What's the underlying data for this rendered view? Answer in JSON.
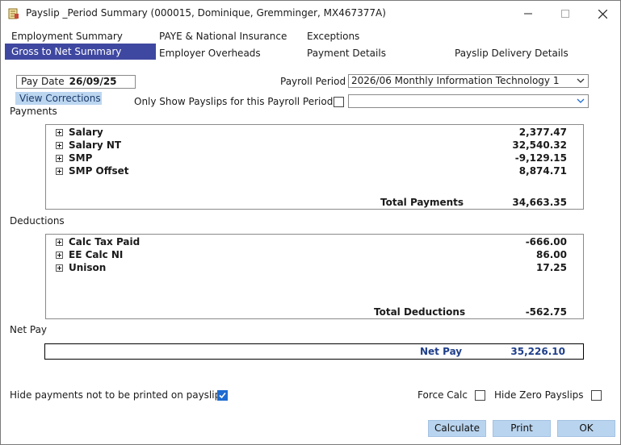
{
  "window": {
    "title": "Payslip _Period Summary (000015, Dominique, Gremminger, MX467377A)",
    "minimize": "—",
    "maximize": "☐",
    "close": "✕"
  },
  "tabs": {
    "employment_summary": "Employment Summary",
    "gross_to_net": "Gross to Net Summary",
    "paye_ni": "PAYE & National Insurance",
    "employer_overheads": "Employer Overheads",
    "exceptions": "Exceptions",
    "payment_details": "Payment Details",
    "payslip_delivery": "Payslip Delivery Details"
  },
  "header": {
    "pay_date_label": "Pay Date",
    "pay_date_value": "26/09/25",
    "view_corrections": "View Corrections",
    "payroll_period_label": "Payroll Period",
    "payroll_period_value": "2026/06 Monthly Information Technology 1",
    "only_show_label": "Only Show Payslips for this Payroll Period",
    "only_show_checked": false,
    "only_show_value": ""
  },
  "payments": {
    "label": "Payments",
    "rows": [
      {
        "name": "Salary",
        "value": "2,377.47"
      },
      {
        "name": "Salary NT",
        "value": "32,540.32"
      },
      {
        "name": "SMP",
        "value": "-9,129.15"
      },
      {
        "name": "SMP Offset",
        "value": "8,874.71"
      }
    ],
    "total_label": "Total Payments",
    "total_value": "34,663.35"
  },
  "deductions": {
    "label": "Deductions",
    "rows": [
      {
        "name": "Calc Tax Paid",
        "value": "-666.00"
      },
      {
        "name": "EE Calc NI",
        "value": "86.00"
      },
      {
        "name": "Unison",
        "value": "17.25"
      }
    ],
    "total_label": "Total Deductions",
    "total_value": "-562.75"
  },
  "net_pay": {
    "section_label": "Net Pay",
    "label": "Net Pay",
    "value": "35,226.10"
  },
  "footer": {
    "hide_payments_label": "Hide payments not to be printed on payslips",
    "hide_payments_checked": true,
    "force_calc_label": "Force Calc",
    "force_calc_checked": false,
    "hide_zero_label": "Hide Zero Payslips",
    "hide_zero_checked": false,
    "calculate": "Calculate",
    "print": "Print",
    "ok": "OK"
  },
  "colors": {
    "active_tab": "#3f48a0",
    "button_bg": "#b9d4ee",
    "net_pay_text": "#1f3f8a",
    "checkbox_checked": "#1e6bd1"
  }
}
